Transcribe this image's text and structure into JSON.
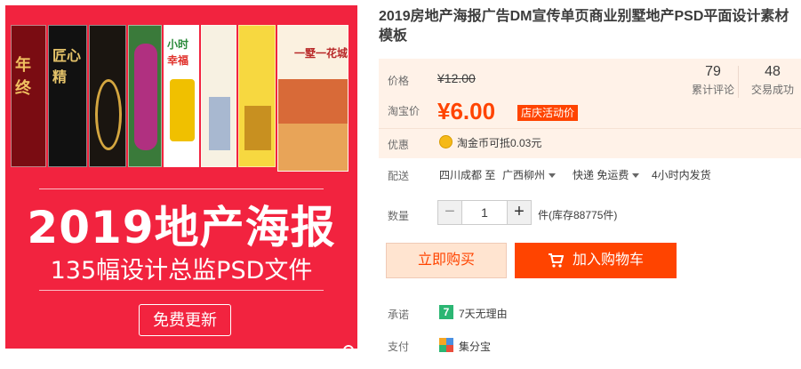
{
  "promo_image": {
    "posters": [
      "年终",
      "匠心精",
      "小时",
      "幸福",
      "一墅一花城"
    ],
    "headline": "2019地产海报",
    "subheadline": "135幅设计总监PSD文件",
    "button_label": "免费更新"
  },
  "product": {
    "title": "2019房地产海报广告DM宣传单页商业别墅地产PSD平面设计素材模板"
  },
  "price": {
    "original_label": "价格",
    "original_value": "¥12.00",
    "current_label": "淘宝价",
    "current_value": "¥6.00",
    "promo_tag": "店庆活动价",
    "accent_color": "#ff4400"
  },
  "stats": {
    "reviews_count": "79",
    "reviews_label": "累计评论",
    "deals_count": "48",
    "deals_label": "交易成功"
  },
  "discount": {
    "label": "优惠",
    "text": "淘金币可抵0.03元",
    "icon": "coin-icon"
  },
  "shipping": {
    "label": "配送",
    "from": "四川成都 至",
    "to": "广西柳州",
    "method": "快递 免运费",
    "dispatch": "4小时内发货"
  },
  "quantity": {
    "label": "数量",
    "value": "1",
    "minus": "−",
    "plus": "+",
    "stock": "件(库存88775件)"
  },
  "actions": {
    "buy_now": "立即购买",
    "add_to_cart": "加入购物车"
  },
  "promise": {
    "label": "承诺",
    "icon_text": "7",
    "text": "7天无理由"
  },
  "payment": {
    "label": "支付",
    "text": "集分宝"
  }
}
